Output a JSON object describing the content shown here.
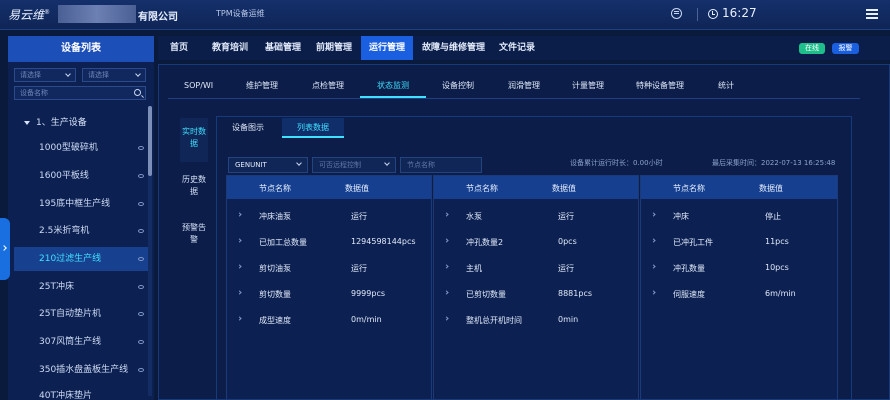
{
  "header": {
    "logo": "易云维",
    "logo_mark": "®",
    "company_suffix": "有限公司",
    "system": "TPM设备运维",
    "time": "16:27"
  },
  "sidebar": {
    "title": "设备列表",
    "filter1": "请选择",
    "filter2": "请选择",
    "search_placeholder": "设备名称",
    "root": "1、生产设备",
    "items": [
      {
        "label": "1000型破碎机"
      },
      {
        "label": "1600平板线"
      },
      {
        "label": "195底中框生产线"
      },
      {
        "label": "2.5米折弯机"
      },
      {
        "label": "210过滤生产线"
      },
      {
        "label": "25T冲床"
      },
      {
        "label": "25T自动垫片机"
      },
      {
        "label": "307风筒生产线"
      },
      {
        "label": "350插水盘盖板生产线"
      },
      {
        "label": "40T冲床垫片"
      }
    ]
  },
  "nav": {
    "items": [
      "首页",
      "教育培训",
      "基础管理",
      "前期管理",
      "运行管理",
      "故障与维修管理",
      "文件记录"
    ],
    "online": "在线",
    "alarm": "报警"
  },
  "subtabs": [
    "SOP/WI",
    "维护管理",
    "点检管理",
    "状态监测",
    "设备控制",
    "润滑管理",
    "计量管理",
    "特种设备管理",
    "统计"
  ],
  "side_tabs": [
    "实时数据",
    "历史数据",
    "预警告警"
  ],
  "view_tabs": [
    "设备图示",
    "列表数据"
  ],
  "filters": {
    "unit": "GENUNIT",
    "ctrl_placeholder": "可否远程控制",
    "node_placeholder": "节点名称",
    "runtime": "设备累计运行时长：0.00小时",
    "lastdata": "最后采集时间：2022-07-13 16:25:48"
  },
  "table": {
    "col_name": "节点名称",
    "col_value": "数据值",
    "panels": [
      [
        {
          "name": "冲床油泵",
          "value": "运行"
        },
        {
          "name": "已加工总数量",
          "value": "1294598144pcs"
        },
        {
          "name": "剪切油泵",
          "value": "运行"
        },
        {
          "name": "剪切数量",
          "value": "9999pcs"
        },
        {
          "name": "成型速度",
          "value": "0m/min"
        }
      ],
      [
        {
          "name": "水泵",
          "value": "运行"
        },
        {
          "name": "冲孔数量2",
          "value": "0pcs"
        },
        {
          "name": "主机",
          "value": "运行"
        },
        {
          "name": "已剪切数量",
          "value": "8881pcs"
        },
        {
          "name": "整机总开机时间",
          "value": "0min"
        }
      ],
      [
        {
          "name": "冲床",
          "value": "停止"
        },
        {
          "name": "已冲孔工件",
          "value": "11pcs"
        },
        {
          "name": "冲孔数量",
          "value": "10pcs"
        },
        {
          "name": "伺服速度",
          "value": "6m/min"
        }
      ]
    ]
  }
}
